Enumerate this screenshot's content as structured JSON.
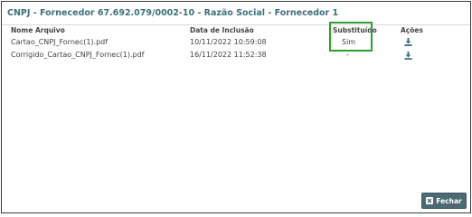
{
  "modal": {
    "title": "CNPJ - Fornecedor 67.692.079/0002-10 - Razão Social - Fornecedor 1"
  },
  "table": {
    "headers": {
      "name": "Nome Arquivo",
      "date": "Data de Inclusão",
      "replaced": "Substituído",
      "actions": "Ações"
    },
    "rows": [
      {
        "name": "Cartao_CNPJ_Fornec(1).pdf",
        "date": "10/11/2022 10:59:08",
        "replaced": "Sim",
        "action_icon": "download-icon"
      },
      {
        "name": "Corrigido_Cartao_CNPJ_Fornec(1).pdf",
        "date": "16/11/2022 11:52:38",
        "replaced": "-",
        "action_icon": "download-icon"
      }
    ]
  },
  "footer": {
    "close_label": "Fechar",
    "close_icon": "close-icon"
  },
  "colors": {
    "title": "#3c6f7a",
    "highlight": "#2e9e2e",
    "button": "#4c6a73",
    "icon": "#3c6f7a"
  }
}
